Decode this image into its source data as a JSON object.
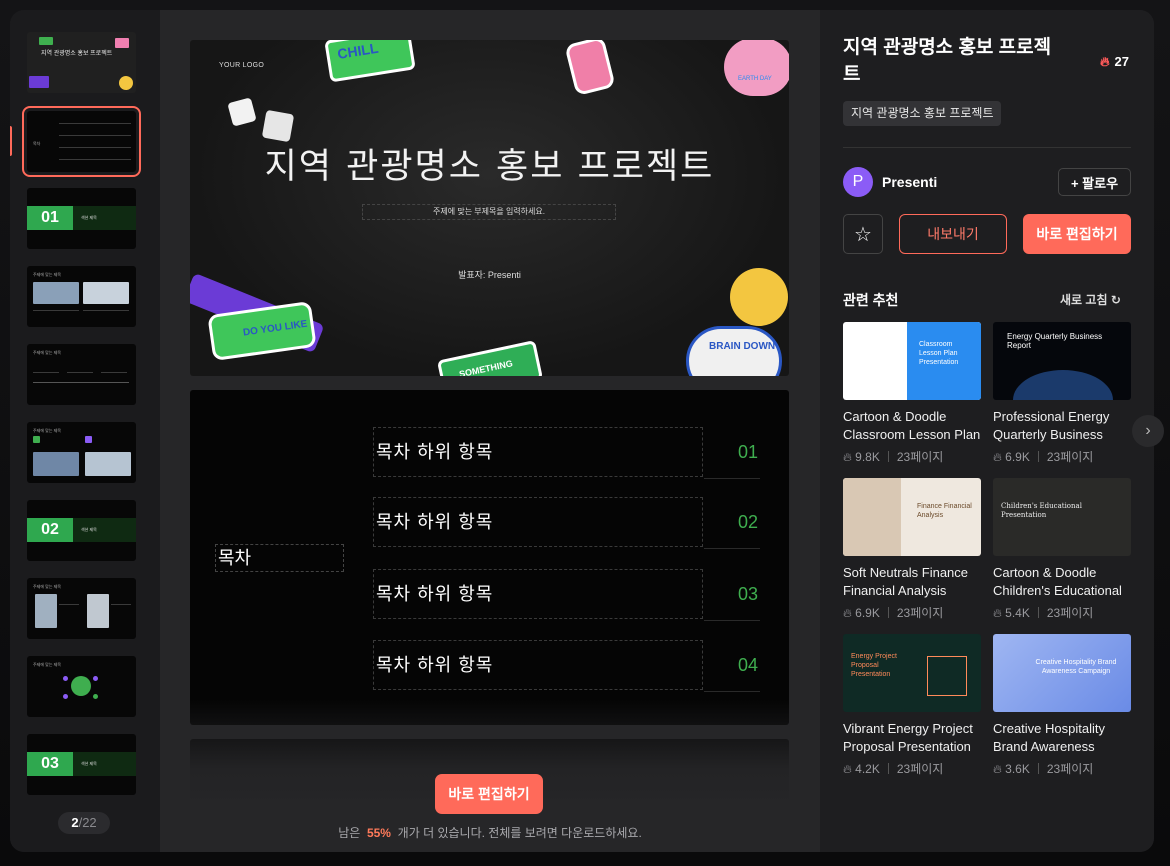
{
  "thumbnails": {
    "current": "2",
    "total": "22",
    "slide1_title": "지역 관광명소 홍보 프로젝트",
    "section_labels": [
      "01",
      "02",
      "03"
    ],
    "section_caption": "섹션 제목",
    "toc_caption": "목차",
    "content_caption": "주제에 맞는 제목"
  },
  "slide1": {
    "logo": "YOUR LOGO",
    "title": "지역 관광명소 홍보 프로젝트",
    "subtitle": "주제에 맞는 부제목을 입력하세요.",
    "presenter": "발표자: Presenti",
    "stickers": [
      "CHILL",
      "EARTH DAY",
      "DO YOU LIKE",
      "SOMETHING",
      "BRAIN DOWN"
    ]
  },
  "slide2": {
    "toc_label": "목차",
    "items": [
      {
        "label": "목차 하위 항목",
        "num": "01"
      },
      {
        "label": "목차 하위 항목",
        "num": "02"
      },
      {
        "label": "목차 하위 항목",
        "num": "03"
      },
      {
        "label": "목차 하위 항목",
        "num": "04"
      }
    ]
  },
  "center": {
    "edit_label": "바로 편집하기",
    "remain_prefix": "남은",
    "remain_percent": "55%",
    "remain_suffix": "개가 더 있습니다. 전체를 보려면 다운로드하세요."
  },
  "side": {
    "title": "지역 관광명소 홍보 프로젝트",
    "likes": "27",
    "tag": "지역 관광명소 홍보 프로젝트",
    "avatar_letter": "P",
    "author": "Presenti",
    "follow_label": "+ 팔로우",
    "export_label": "내보내기",
    "edit_label": "바로 편집하기",
    "related_title": "관련 추천",
    "refresh_label": "새로 고침 ↻"
  },
  "related": [
    {
      "title": "Cartoon & Doodle Classroom Lesson Plan Pre...",
      "views": "9.8K",
      "pages": "23페이지",
      "thumb_text": "Classroom Lesson Plan Presentation",
      "accent": "#2a8cf0"
    },
    {
      "title": "Professional Energy Quarterly Business Repor...",
      "views": "6.9K",
      "pages": "23페이지",
      "thumb_text": "Energy Quarterly Business Report",
      "accent": "#0e1a2b"
    },
    {
      "title": "Soft Neutrals Finance Financial Analysis Prese...",
      "views": "6.9K",
      "pages": "23페이지",
      "thumb_text": "Finance Financial Analysis",
      "accent": "#efe8df"
    },
    {
      "title": "Cartoon & Doodle Children's Educational Prese...",
      "views": "5.4K",
      "pages": "23페이지",
      "thumb_text": "Children's Educational Presentation",
      "accent": "#2a2a28"
    },
    {
      "title": "Vibrant Energy Project Proposal Presentation ...",
      "views": "4.2K",
      "pages": "23페이지",
      "thumb_text": "Energy Project Proposal Presentation",
      "accent": "#0f2a25"
    },
    {
      "title": "Creative Hospitality Brand Awareness Campai...",
      "views": "3.6K",
      "pages": "23페이지",
      "thumb_text": "Creative Hospitality Brand Awareness Campaign",
      "accent": "#8ea8ee"
    }
  ]
}
